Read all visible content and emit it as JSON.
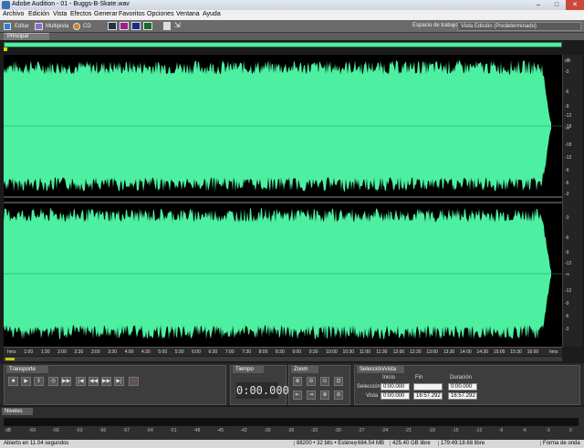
{
  "window": {
    "title": "Adobe Audition - 01 - Buggs-B-Skate.wav",
    "controls": [
      "–",
      "□",
      "✕"
    ]
  },
  "menu": [
    "Archivo",
    "Edición",
    "Vista",
    "Efectos",
    "Generar",
    "Favoritos",
    "Opciones",
    "Ventana",
    "Ayuda"
  ],
  "toolbar": {
    "edit_label": "Editar",
    "multitrack_label": "Multipista",
    "cd_label": "CD",
    "workspace_label": "Espacio de trabajo:",
    "workspace_value": "Vista Edición (Predeterminado)"
  },
  "main_tab": "Principal",
  "colors": {
    "waveform": "#4cf0a0",
    "background": "#000000",
    "accent": "#d8d800"
  },
  "db_scale": [
    "-3",
    "-6",
    "-9",
    "-12",
    "-18",
    "-∞",
    "-18",
    "-12",
    "-9",
    "-6",
    "-3"
  ],
  "db_header": "dB",
  "timeline_labels": [
    "hms",
    "1:00",
    "1:30",
    "2:00",
    "2:30",
    "3:00",
    "3:30",
    "4:00",
    "4:30",
    "5:00",
    "5:30",
    "6:00",
    "6:30",
    "7:00",
    "7:30",
    "8:00",
    "8:30",
    "9:00",
    "9:30",
    "10:00",
    "10:30",
    "11:00",
    "11:30",
    "12:00",
    "12:30",
    "13:00",
    "13:30",
    "14:00",
    "14:30",
    "15:00",
    "15:30",
    "16:00",
    "hms"
  ],
  "transport": {
    "tab": "Transporte",
    "buttons": [
      "■",
      "▶",
      "‖",
      "◎",
      "▶▶",
      "|◀",
      "◀◀",
      "▶▶",
      "▶|",
      "●"
    ]
  },
  "time": {
    "tab": "Tiempo",
    "value": "0:00.000"
  },
  "zoom": {
    "tab": "Zoom"
  },
  "selection": {
    "tab": "Selección/vista",
    "col_start": "Inicio",
    "col_end": "Fin",
    "col_duration": "Duración",
    "row_selection": "Selección",
    "row_view": "Vista",
    "sel_start": "0:00.000",
    "sel_end": "",
    "sel_duration": "0:00.000",
    "view_start": "0:00.000",
    "view_end": "16:57.292",
    "view_duration": "16:57.292"
  },
  "levels": {
    "tab": "Niveles",
    "scale": [
      "dB",
      "-69",
      "-66",
      "-63",
      "-60",
      "-57",
      "-54",
      "-51",
      "-48",
      "-45",
      "-42",
      "-39",
      "-36",
      "-33",
      "-30",
      "-27",
      "-24",
      "-21",
      "-18",
      "-15",
      "-12",
      "-9",
      "-6",
      "-3",
      "0"
    ]
  },
  "status": {
    "message": "Abierto en 11.04 segundos",
    "format": "88200 • 32 bits • Estéreo",
    "size": "684.54 MB",
    "free_space": "425.40 GB libre",
    "free_time": "179:49:18.68 libre",
    "view": "Forma de onda"
  }
}
